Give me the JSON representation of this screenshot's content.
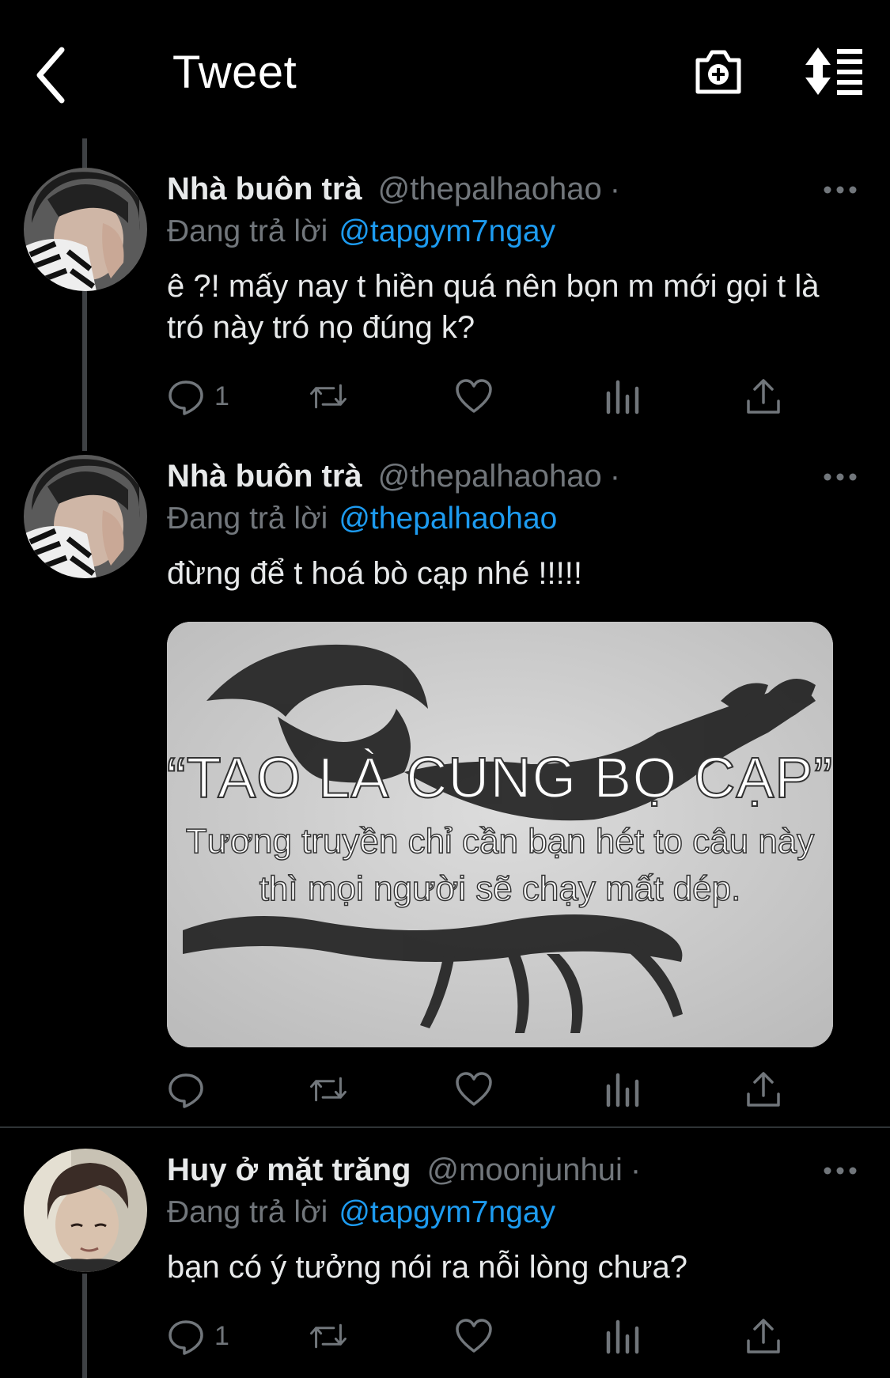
{
  "header": {
    "title": "Tweet",
    "icons": [
      "back-arrow-icon",
      "camera-plus-icon",
      "sort-icon"
    ]
  },
  "tweets": [
    {
      "name": "Nhà buôn trà",
      "handle": "@thepalhaohao",
      "dot": "·",
      "reply_prefix": "Đang trả lời",
      "reply_to": "@tapgym7ngay",
      "text": "ê ?! mấy nay t hiền quá nên bọn m mới gọi t là tró này tró nọ đúng k?",
      "reply_count": "1"
    },
    {
      "name": "Nhà buôn trà",
      "handle": "@thepalhaohao",
      "dot": "·",
      "reply_prefix": "Đang trả lời",
      "reply_to": "@thepalhaohao",
      "text": "đừng để t hoá bò cạp nhé !!!!!",
      "reply_count": "",
      "media": {
        "line1": "“TAO LÀ CUNG BỌ CẠP”",
        "line2": "Tương truyền chỉ cần bạn hét to câu này",
        "line3": "thì mọi người sẽ chạy mất dép."
      }
    },
    {
      "name": "Huy ở mặt trăng",
      "handle": "@moonjunhui",
      "dot": "·",
      "reply_prefix": "Đang trả lời",
      "reply_to": "@tapgym7ngay",
      "text": "bạn có ý tưởng nói ra nỗi lòng chưa?",
      "reply_count": "1"
    }
  ],
  "colors": {
    "background": "#000000",
    "text": "#e7e9ea",
    "muted": "#71767b",
    "link": "#1d9bf0",
    "thread_line": "#3e4144"
  }
}
